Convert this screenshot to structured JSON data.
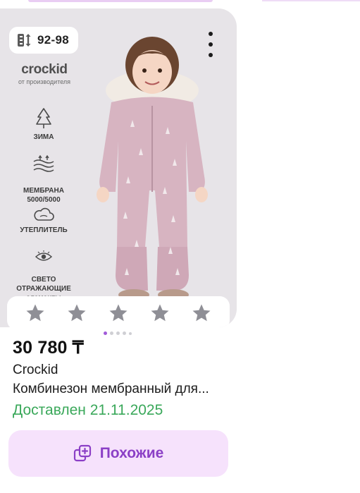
{
  "card": {
    "size_range": "92-98",
    "brand_logo": "crockid",
    "brand_logo_sub": "от производителя",
    "features": [
      {
        "icon": "tree-icon",
        "label": "ЗИМА"
      },
      {
        "icon": "membrane-icon",
        "label": "МЕМБРАНА\n5000/5000"
      },
      {
        "icon": "cloud-icon",
        "label": "УТЕПЛИТЕЛЬ"
      },
      {
        "icon": "eye-icon",
        "label": "СВЕТО\nОТРАЖАЮЩИЕ\nэлементы"
      }
    ],
    "rating": 0,
    "rating_max": 5,
    "image_count": 5,
    "active_image": 1
  },
  "product": {
    "price": "30 780 ₸",
    "brand": "Crockid",
    "title": "Комбинезон мембранный для...",
    "delivery_status": "Доставлен 21.11.2025"
  },
  "actions": {
    "similar_label": "Похожие"
  },
  "colors": {
    "accent": "#8b3fc6",
    "button_bg": "#f6e2fc",
    "delivered": "#3aa85a",
    "star": "#8f8f96"
  }
}
